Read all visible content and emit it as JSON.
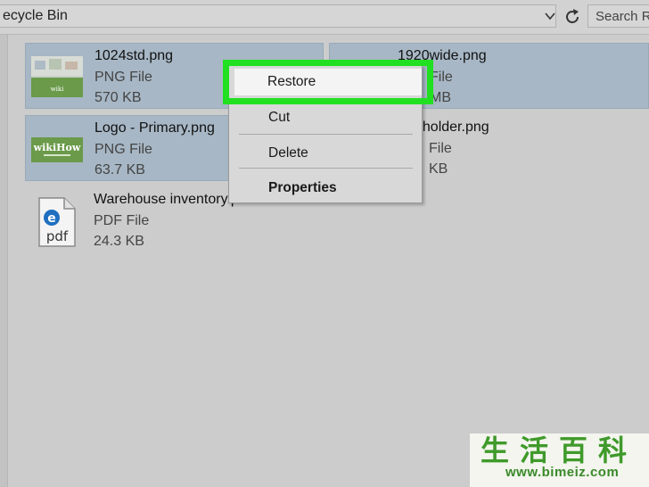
{
  "address_bar": {
    "path": "ecycle Bin",
    "search_placeholder": "Search R"
  },
  "files": [
    {
      "name": "1024std.png",
      "type": "PNG File",
      "size": "570 KB",
      "selected": true,
      "thumb": "wikihow-image"
    },
    {
      "name": "1920wide.png",
      "type": "File",
      "size": "MB",
      "selected": true,
      "thumb": "none"
    },
    {
      "name": "Logo - Primary.png",
      "type": "PNG File",
      "size": "63.7 KB",
      "selected": true,
      "thumb": "wikihow-logo"
    },
    {
      "name": "eholder.png",
      "type": "File",
      "size": "KB",
      "selected": false,
      "thumb": "none"
    },
    {
      "name": "Warehouse inventory.pdf",
      "type": "PDF File",
      "size": "24.3 KB",
      "selected": false,
      "thumb": "pdf-icon"
    }
  ],
  "context_menu": {
    "items": [
      "Restore",
      "Cut",
      "Delete",
      "Properties"
    ],
    "highlighted": "Restore"
  },
  "logo_text": {
    "thumb_logo": "wikiHow",
    "thumb_small": "wiki",
    "pdf_label": "pdf"
  },
  "watermark": {
    "chars": "生活百科",
    "url": "www.bimeiz.com"
  },
  "colors": {
    "highlight_green": "#21e021",
    "selection_blue": "#a7b7c5",
    "wikihow_green": "#6a9a4a"
  }
}
